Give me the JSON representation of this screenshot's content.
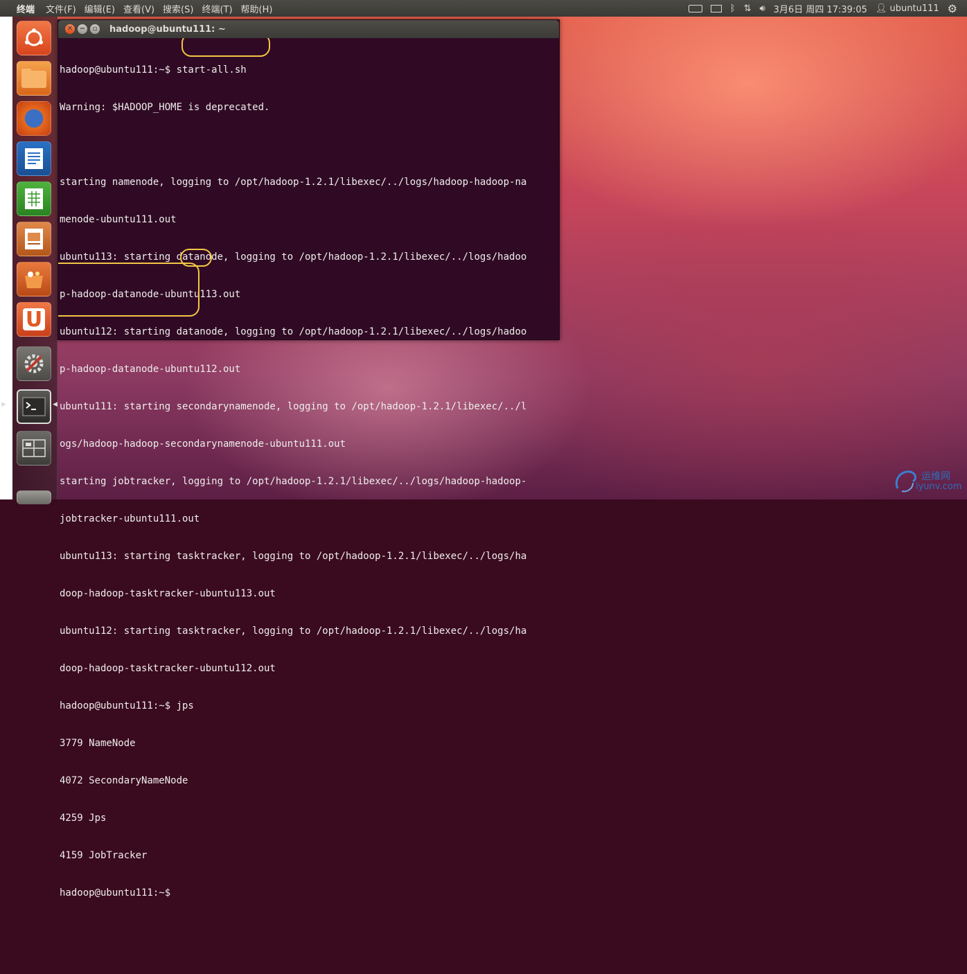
{
  "top_panel": {
    "app_name": "终端",
    "menu": [
      "文件(F)",
      "编辑(E)",
      "查看(V)",
      "搜索(S)",
      "终端(T)",
      "帮助(H)"
    ],
    "datetime": "3月6日 周四 17:39:05",
    "user": "ubuntu111"
  },
  "terminal": {
    "title": "hadoop@ubuntu111: ~",
    "lines": [
      "hadoop@ubuntu111:~$ start-all.sh",
      "Warning: $HADOOP_HOME is deprecated.",
      "",
      "starting namenode, logging to /opt/hadoop-1.2.1/libexec/../logs/hadoop-hadoop-na",
      "menode-ubuntu111.out",
      "ubuntu113: starting datanode, logging to /opt/hadoop-1.2.1/libexec/../logs/hadoo",
      "p-hadoop-datanode-ubuntu113.out",
      "ubuntu112: starting datanode, logging to /opt/hadoop-1.2.1/libexec/../logs/hadoo",
      "p-hadoop-datanode-ubuntu112.out",
      "ubuntu111: starting secondarynamenode, logging to /opt/hadoop-1.2.1/libexec/../l",
      "ogs/hadoop-hadoop-secondarynamenode-ubuntu111.out",
      "starting jobtracker, logging to /opt/hadoop-1.2.1/libexec/../logs/hadoop-hadoop-",
      "jobtracker-ubuntu111.out",
      "ubuntu113: starting tasktracker, logging to /opt/hadoop-1.2.1/libexec/../logs/ha",
      "doop-hadoop-tasktracker-ubuntu113.out",
      "ubuntu112: starting tasktracker, logging to /opt/hadoop-1.2.1/libexec/../logs/ha",
      "doop-hadoop-tasktracker-ubuntu112.out",
      "hadoop@ubuntu111:~$ jps",
      "3779 NameNode",
      "4072 SecondaryNameNode",
      "4259 Jps",
      "4159 JobTracker",
      "hadoop@ubuntu111:~$ "
    ]
  },
  "launcher": [
    "ubuntu-dash-icon",
    "files-icon",
    "firefox-icon",
    "writer-icon",
    "calc-icon",
    "impress-icon",
    "software-center-icon",
    "ubuntu-one-icon",
    "system-settings-icon",
    "terminal-icon",
    "workspace-switcher-icon",
    "trash-icon"
  ],
  "watermark": {
    "cn": "运维网",
    "url": "iyunv.com"
  },
  "colors": {
    "terminal_bg": "#300a24",
    "highlight": "#f3c646",
    "panel": "#3c3b37"
  }
}
